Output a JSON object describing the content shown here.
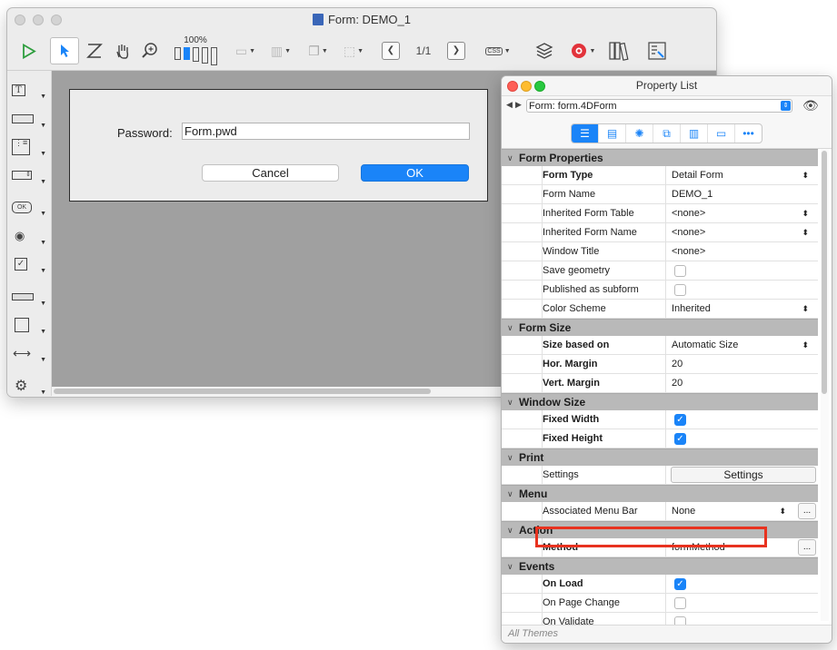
{
  "form_window": {
    "title": "Form: DEMO_1",
    "zoom_label": "100%",
    "page_indicator": "1/1",
    "css_label": "CSS",
    "dialog": {
      "password_label": "Password:",
      "password_value": "Form.pwd",
      "cancel_label": "Cancel",
      "ok_label": "OK"
    }
  },
  "property_list": {
    "title": "Property List",
    "form_selector": "Form: form.4DForm",
    "sections": [
      {
        "title": "Form Properties",
        "rows": [
          {
            "name": "Form Type",
            "bold": true,
            "value": "Detail Form",
            "control": "select"
          },
          {
            "name": "Form Name",
            "bold": false,
            "value": "DEMO_1",
            "control": "text"
          },
          {
            "name": "Inherited Form Table",
            "bold": false,
            "value": "<none>",
            "control": "select"
          },
          {
            "name": "Inherited Form Name",
            "bold": false,
            "value": "<none>",
            "control": "select"
          },
          {
            "name": "Window Title",
            "bold": false,
            "value": "<none>",
            "control": "text"
          },
          {
            "name": "Save geometry",
            "bold": false,
            "checked": false,
            "control": "checkbox"
          },
          {
            "name": "Published as subform",
            "bold": false,
            "checked": false,
            "control": "checkbox"
          },
          {
            "name": "Color Scheme",
            "bold": false,
            "value": "Inherited",
            "control": "select"
          }
        ]
      },
      {
        "title": "Form Size",
        "rows": [
          {
            "name": "Size based on",
            "bold": true,
            "value": "Automatic Size",
            "control": "select"
          },
          {
            "name": "Hor. Margin",
            "bold": true,
            "value": "20",
            "control": "text"
          },
          {
            "name": "Vert. Margin",
            "bold": true,
            "value": "20",
            "control": "text"
          }
        ]
      },
      {
        "title": "Window Size",
        "rows": [
          {
            "name": "Fixed Width",
            "bold": true,
            "checked": true,
            "control": "checkbox"
          },
          {
            "name": "Fixed Height",
            "bold": true,
            "checked": true,
            "control": "checkbox"
          }
        ]
      },
      {
        "title": "Print",
        "rows": [
          {
            "name": "Settings",
            "bold": false,
            "value": "Settings",
            "control": "button"
          }
        ]
      },
      {
        "title": "Menu",
        "rows": [
          {
            "name": "Associated Menu Bar",
            "bold": false,
            "value": "None",
            "control": "select-ellipsis"
          }
        ]
      },
      {
        "title": "Action",
        "rows": [
          {
            "name": "Method",
            "bold": true,
            "value": "formMethod",
            "control": "text-ellipsis"
          }
        ]
      },
      {
        "title": "Events",
        "rows": [
          {
            "name": "On Load",
            "bold": true,
            "checked": true,
            "control": "checkbox"
          },
          {
            "name": "On Page Change",
            "bold": false,
            "checked": false,
            "control": "checkbox"
          },
          {
            "name": "On Validate",
            "bold": false,
            "checked": false,
            "control": "checkbox"
          },
          {
            "name": "",
            "bold": false,
            "checked": false,
            "control": "checkbox"
          }
        ]
      }
    ],
    "ellipsis_label": "...",
    "theme_label": "All Themes"
  },
  "colors": {
    "accent": "#1a84f8",
    "highlight": "#e8321f",
    "section_header": "#b9b9b9",
    "canvas": "#a0a0a0"
  }
}
